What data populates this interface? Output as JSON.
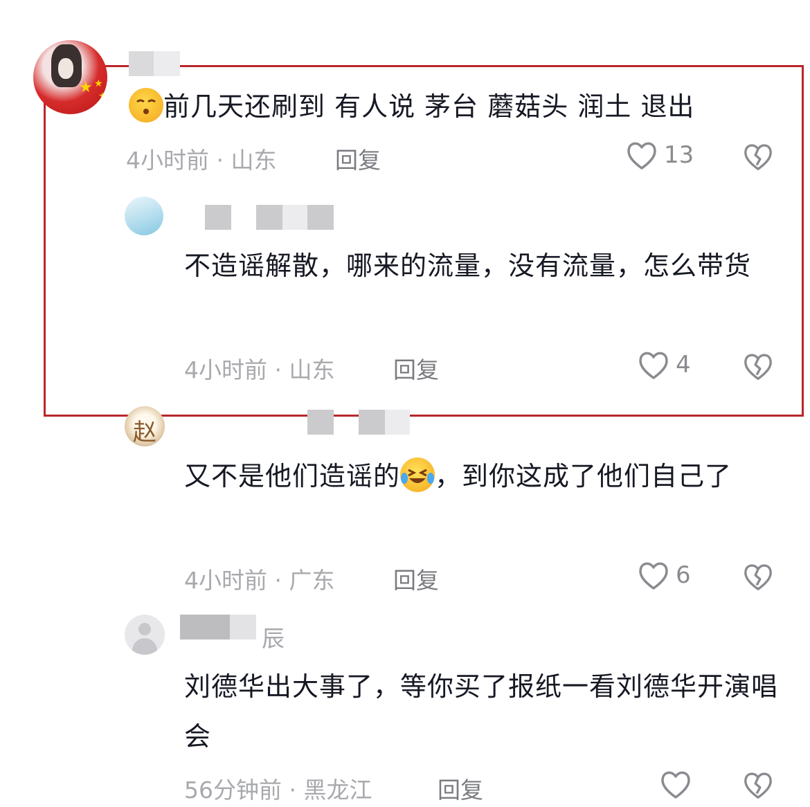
{
  "comments": [
    {
      "text_prefix": "",
      "text": "前几天还刷到 有人说 茅台  蘑菇头  润土 退出",
      "time_location": "4小时前 · 山东",
      "reply_label": "回复",
      "likes": "13"
    },
    {
      "text": "不造谣解散，哪来的流量，没有流量，怎么带货",
      "time_location": "4小时前 · 山东",
      "reply_label": "回复",
      "likes": "4"
    },
    {
      "text_before_emoji": "又不是他们造谣的",
      "text_after_emoji": "，到你这成了他们自己了",
      "time_location": "4小时前 · 广东",
      "reply_label": "回复",
      "likes": "6"
    },
    {
      "username_visible": "辰",
      "text": "刘德华出大事了，等你买了报纸一看刘德华开演唱会",
      "time_location": "56分钟前 · 黑龙江",
      "reply_label": "回复",
      "likes": ""
    }
  ],
  "avatar_glyph_3": "赵",
  "colors": {
    "highlight_border": "#b8262a",
    "meta_text": "#a8a9ad"
  }
}
